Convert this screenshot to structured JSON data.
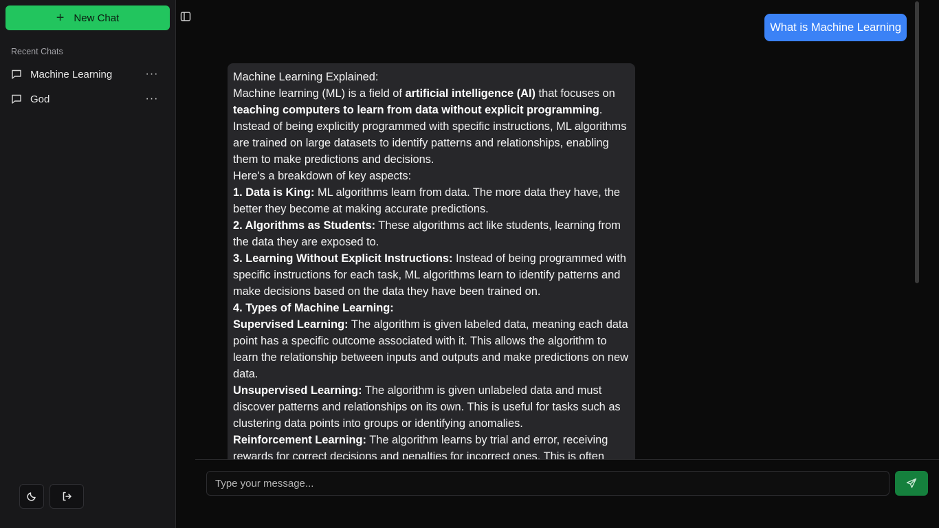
{
  "sidebar": {
    "new_chat_label": "New Chat",
    "recent_label": "Recent Chats",
    "items": [
      {
        "label": "Machine Learning",
        "more": "···"
      },
      {
        "label": "God",
        "more": "···"
      }
    ],
    "footer": {
      "theme_icon": "moon-icon",
      "logout_icon": "logout-icon"
    }
  },
  "conversation": {
    "user_message": "What is Machine Learning",
    "assistant": {
      "heading": "Machine Learning Explained:",
      "intro_1": "Machine learning (ML) is a field of ",
      "intro_bold_1": "artificial intelligence (AI)",
      "intro_2": " that focuses on ",
      "intro_bold_2": "teaching computers to learn from data without explicit programming",
      "intro_3": ".",
      "intro_para": "Instead of being explicitly programmed with specific instructions, ML algorithms are trained on large datasets to identify patterns and relationships, enabling them to make predictions and decisions.",
      "breakdown": "Here's a breakdown of key aspects:",
      "points": [
        {
          "title": "1. Data is King:",
          "text": " ML algorithms learn from data. The more data they have, the better they become at making accurate predictions."
        },
        {
          "title": "2. Algorithms as Students:",
          "text": " These algorithms act like students, learning from the data they are exposed to."
        },
        {
          "title": "3. Learning Without Explicit Instructions:",
          "text": " Instead of being programmed with specific instructions for each task, ML algorithms learn to identify patterns and make decisions based on the data they have been trained on."
        },
        {
          "title": "4. Types of Machine Learning:",
          "text": ""
        }
      ],
      "types": [
        {
          "title": "Supervised Learning:",
          "text": " The algorithm is given labeled data, meaning each data point has a specific outcome associated with it. This allows the algorithm to learn the relationship between inputs and outputs and make predictions on new data."
        },
        {
          "title": "Unsupervised Learning:",
          "text": " The algorithm is given unlabeled data and must discover patterns and relationships on its own. This is useful for tasks such as clustering data points into groups or identifying anomalies."
        },
        {
          "title": "Reinforcement Learning:",
          "text": " The algorithm learns by trial and error, receiving rewards for correct decisions and penalties for incorrect ones. This is often"
        }
      ]
    }
  },
  "composer": {
    "placeholder": "Type your message...",
    "send_icon": "send-icon"
  },
  "colors": {
    "accent_green": "#22c55e",
    "send_green": "#15803d",
    "user_bubble": "#3b82f6",
    "assistant_bubble": "#27272a"
  }
}
